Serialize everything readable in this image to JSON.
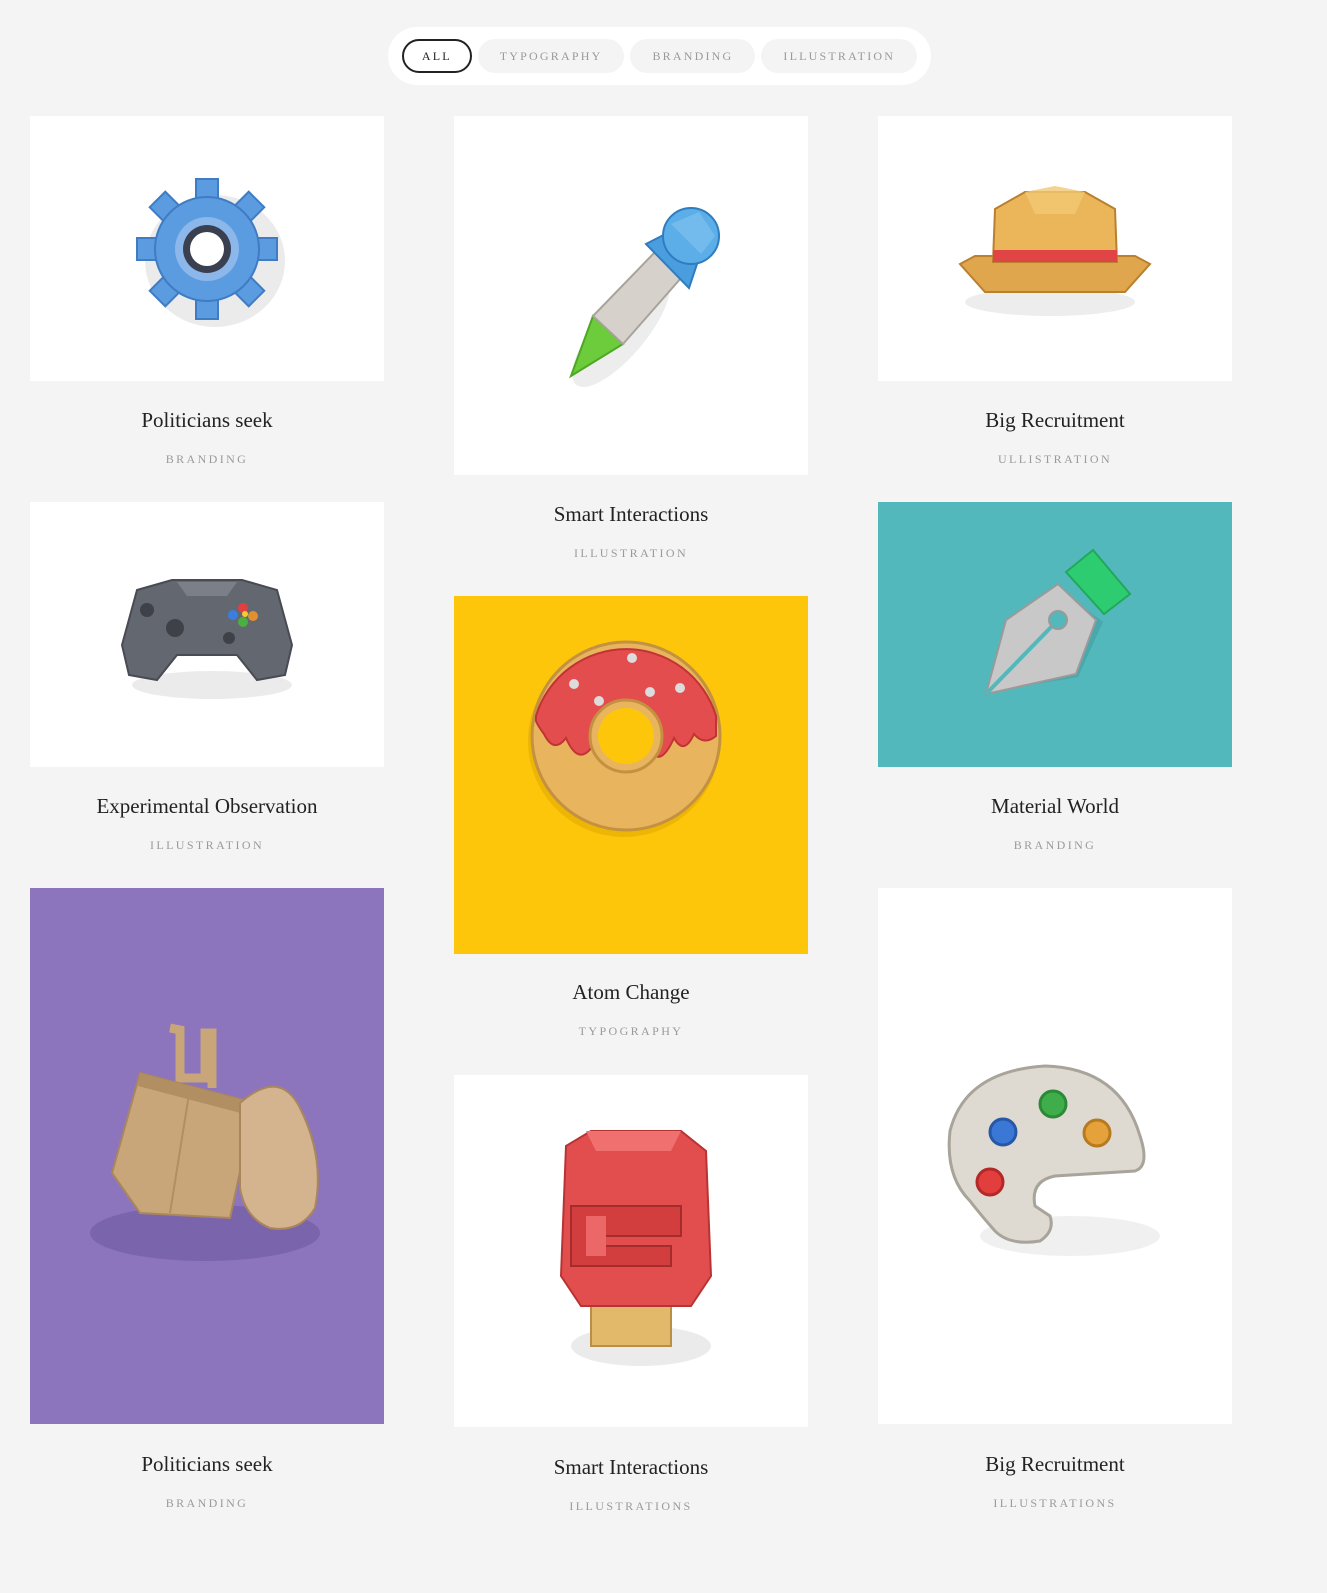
{
  "filters": [
    {
      "label": "ALL",
      "active": true
    },
    {
      "label": "TYPOGRAPHY",
      "active": false
    },
    {
      "label": "BRANDING",
      "active": false
    },
    {
      "label": "ILLUSTRATION",
      "active": false
    }
  ],
  "items": [
    {
      "title": "Politicians seek",
      "category": "BRANDING",
      "image": "gear-icon",
      "bg": "#ffffff"
    },
    {
      "title": "Smart Interactions",
      "category": "ILLUSTRATION",
      "image": "eyedropper-icon",
      "bg": "#ffffff"
    },
    {
      "title": "Big Recruitment",
      "category": "ULLISTRATION",
      "image": "hat-icon",
      "bg": "#ffffff"
    },
    {
      "title": "Experimental Observation",
      "category": "ILLUSTRATION",
      "image": "gamepad-icon",
      "bg": "#ffffff"
    },
    {
      "title": "Atom Change",
      "category": "TYPOGRAPHY",
      "image": "donut-icon",
      "bg": "#fdc60b"
    },
    {
      "title": "Material World",
      "category": "BRANDING",
      "image": "pen-nib-icon",
      "bg": "#52b8bb"
    },
    {
      "title": "Politicians seek",
      "category": "BRANDING",
      "image": "bag-icon",
      "bg": "#8c75bd"
    },
    {
      "title": "Smart Interactions",
      "category": "ILLUSTRATIONS",
      "image": "fire-hydrant-icon",
      "bg": "#ffffff"
    },
    {
      "title": "Big Recruitment",
      "category": "ILLUSTRATIONS",
      "image": "palette-icon",
      "bg": "#ffffff"
    }
  ]
}
